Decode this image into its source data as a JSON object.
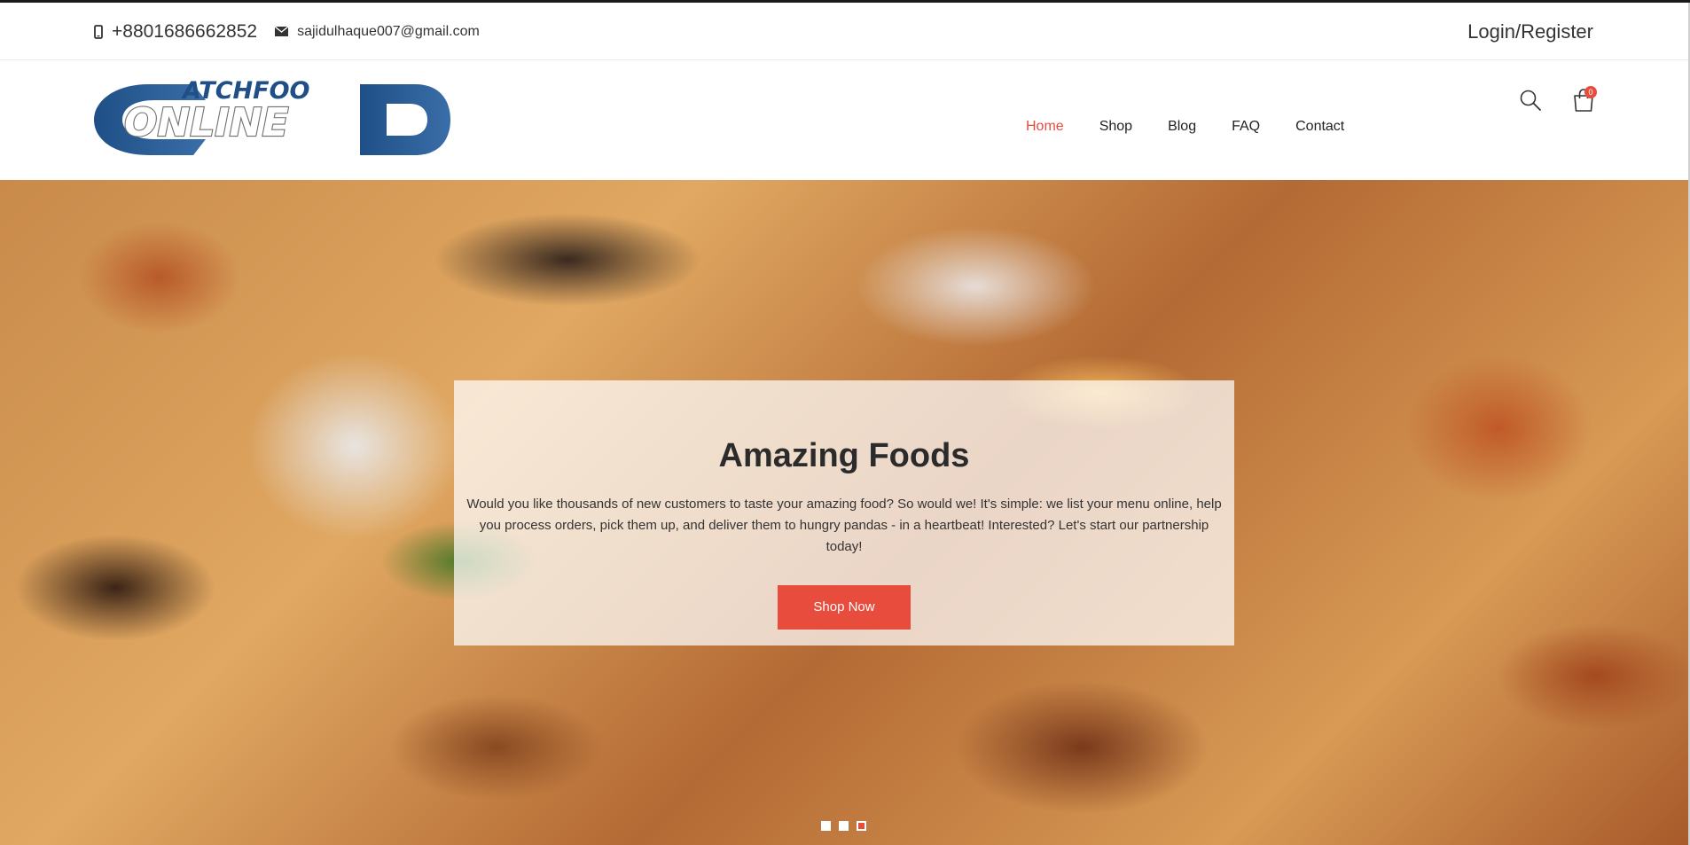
{
  "topbar": {
    "phone": "+8801686662852",
    "email": "sajidulhaque007@gmail.com",
    "login_label": "Login/Register"
  },
  "logo": {
    "line1": "ATCHFOO",
    "line2": "ONLINE",
    "letter_c": "C",
    "letter_d": "D"
  },
  "nav": {
    "items": [
      "Home",
      "Shop",
      "Blog",
      "FAQ",
      "Contact"
    ],
    "active": "Home"
  },
  "cart": {
    "count": "0"
  },
  "hero": {
    "title": "Amazing Foods",
    "text": "Would you like thousands of new customers to taste your amazing food? So would we! It's simple: we list your menu online, help you process orders, pick them up, and deliver them to hungry pandas - in a heartbeat! Interested? Let's start our partnership today!",
    "button_label": "Shop Now",
    "slides_total": 3,
    "slide_active": 3
  },
  "colors": {
    "accent": "#e84c3d",
    "logo_blue": "#2c5a94",
    "logo_gray": "#8a8a8a"
  }
}
